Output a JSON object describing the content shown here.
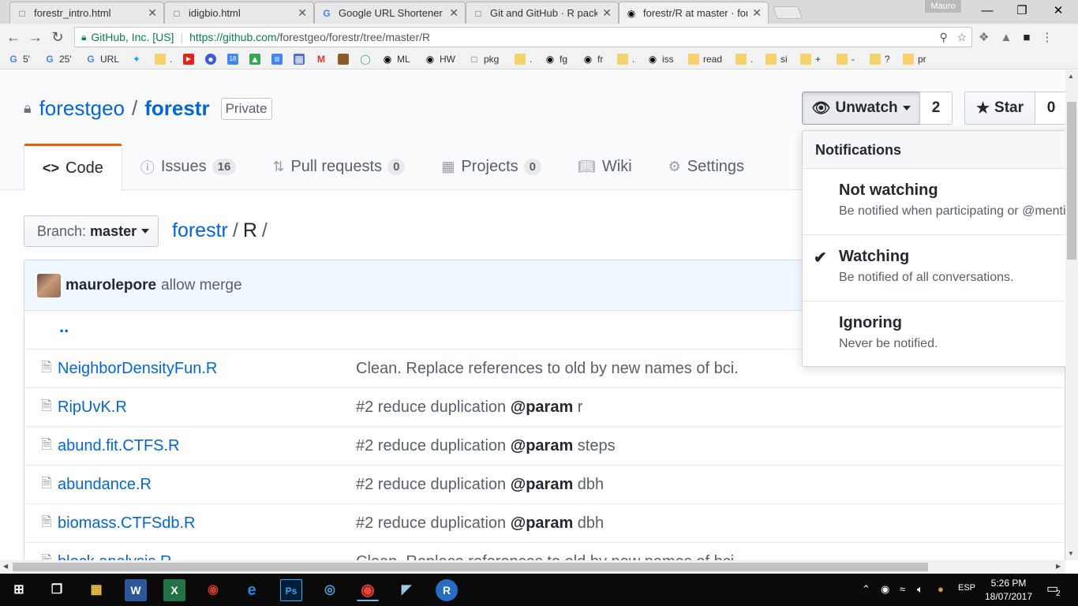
{
  "browser": {
    "tabs": [
      {
        "label": "forestr_intro.html",
        "icon": "document-icon"
      },
      {
        "label": "idigbio.html",
        "icon": "document-icon"
      },
      {
        "label": "Google URL Shortener",
        "icon": "google-icon"
      },
      {
        "label": "Git and GitHub · R packa",
        "icon": "document-icon"
      },
      {
        "label": "forestr/R at master · fore",
        "icon": "github-icon"
      }
    ],
    "user": "Mauro",
    "secure_label": "GitHub, Inc. [US]",
    "url_host": "https://github.com",
    "url_path": "/forestgeo/forestr/tree/master/R",
    "bookmarks": [
      "5'",
      "25'",
      "URL",
      "",
      "",
      "",
      "",
      "",
      "",
      "",
      "",
      "",
      "",
      "",
      "",
      "ML",
      "HW",
      "pkg",
      "",
      "fg",
      "fr",
      "",
      "iss",
      "read",
      "",
      "si",
      "+",
      "-",
      "?",
      "pr"
    ]
  },
  "repo": {
    "owner": "forestgeo",
    "name": "forestr",
    "visibility": "Private",
    "watch_label": "Unwatch",
    "watch_count": "2",
    "star_label": "Star",
    "star_count": "0",
    "nav": [
      {
        "label": "Code",
        "icon": "code-icon",
        "count": ""
      },
      {
        "label": "Issues",
        "icon": "issue-icon",
        "count": "16"
      },
      {
        "label": "Pull requests",
        "icon": "pull-request-icon",
        "count": "0"
      },
      {
        "label": "Projects",
        "icon": "project-icon",
        "count": "0"
      },
      {
        "label": "Wiki",
        "icon": "book-icon",
        "count": ""
      },
      {
        "label": "Settings",
        "icon": "gear-icon",
        "count": ""
      }
    ],
    "branch_prefix": "Branch:",
    "branch": "master",
    "path_root": "forestr",
    "path_dir": "R",
    "path_sep": "/",
    "commit_author": "maurolepore",
    "commit_message": "allow merge",
    "up_dir": "..",
    "files": [
      {
        "name": "NeighborDensityFun.R",
        "msg": "Clean. Replace references to old by new names of bci.",
        "kw": "",
        "tail": ""
      },
      {
        "name": "RipUvK.R",
        "msg": "#2 reduce duplication",
        "kw": "@param",
        "tail": "r"
      },
      {
        "name": "abund.fit.CTFS.R",
        "msg": "#2 reduce duplication",
        "kw": "@param",
        "tail": "steps"
      },
      {
        "name": "abundance.R",
        "msg": "#2 reduce duplication",
        "kw": "@param",
        "tail": "dbh"
      },
      {
        "name": "biomass.CTFSdb.R",
        "msg": "#2 reduce duplication",
        "kw": "@param",
        "tail": "dbh"
      },
      {
        "name": "block.analysis.R",
        "msg": "Clean. Replace references to old by new names of bci.",
        "kw": "",
        "tail": ""
      }
    ]
  },
  "notifications": {
    "title": "Notifications",
    "options": [
      {
        "title": "Not watching",
        "desc": "Be notified when participating or @mentioned.",
        "checked": false
      },
      {
        "title": "Watching",
        "desc": "Be notified of all conversations.",
        "checked": true
      },
      {
        "title": "Ignoring",
        "desc": "Never be notified.",
        "checked": false
      }
    ]
  },
  "taskbar": {
    "lang": "ESP",
    "time": "5:26 PM",
    "date": "18/07/2017",
    "notifications_count": "2"
  },
  "colors": {
    "link": "#0366d6",
    "selected_tab_accent": "#e36209",
    "commit_bar": "#f1f8ff"
  }
}
